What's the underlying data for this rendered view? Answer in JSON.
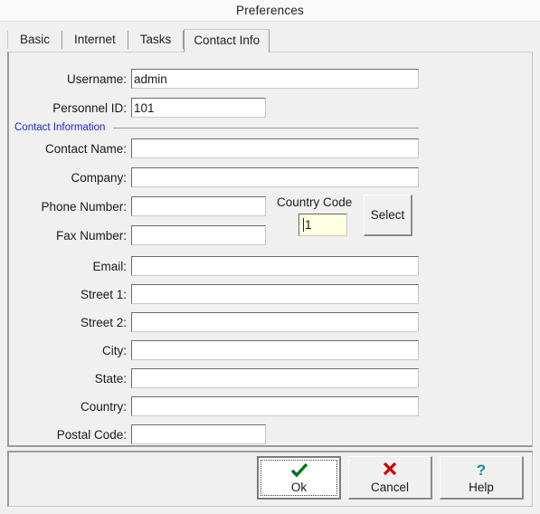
{
  "window": {
    "title": "Preferences"
  },
  "tabs": [
    {
      "label": "Basic",
      "active": false
    },
    {
      "label": "Internet",
      "active": false
    },
    {
      "label": "Tasks",
      "active": false
    },
    {
      "label": "Contact Info",
      "active": true
    }
  ],
  "form": {
    "username": {
      "label": "Username:",
      "value": "admin"
    },
    "personnel_id": {
      "label": "Personnel ID:",
      "value": "101"
    },
    "group_label": "Contact Information",
    "contact_name": {
      "label": "Contact Name:",
      "value": ""
    },
    "company": {
      "label": "Company:",
      "value": ""
    },
    "phone_number": {
      "label": "Phone Number:",
      "value": ""
    },
    "fax_number": {
      "label": "Fax Number:",
      "value": ""
    },
    "email": {
      "label": "Email:",
      "value": ""
    },
    "street1": {
      "label": "Street 1:",
      "value": ""
    },
    "street2": {
      "label": "Street 2:",
      "value": ""
    },
    "city": {
      "label": "City:",
      "value": ""
    },
    "state": {
      "label": "State:",
      "value": ""
    },
    "country": {
      "label": "Country:",
      "value": ""
    },
    "postal_code": {
      "label": "Postal Code:",
      "value": ""
    },
    "country_code": {
      "label": "Country Code",
      "value": "1"
    },
    "select_button": "Select"
  },
  "buttons": {
    "ok": {
      "label": "Ok",
      "icon": "check-icon"
    },
    "cancel": {
      "label": "Cancel",
      "icon": "cross-icon"
    },
    "help": {
      "label": "Help",
      "icon": "question-icon"
    }
  },
  "colors": {
    "group_label": "#2222dd",
    "country_code_bg": "#ffffe4",
    "ok_icon": "#008000",
    "cancel_icon": "#cc0000",
    "help_icon": "#0b8f9e"
  }
}
